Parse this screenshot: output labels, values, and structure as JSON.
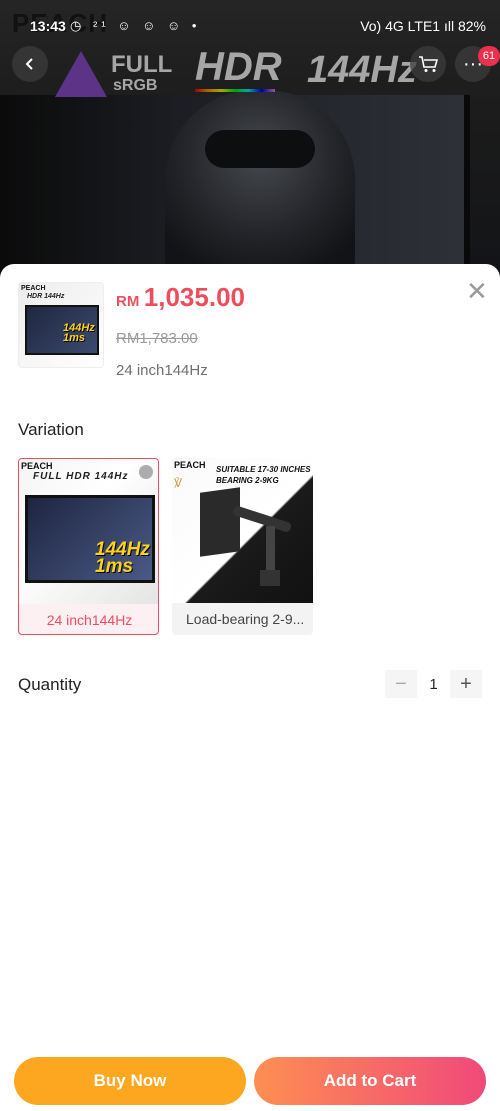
{
  "status_bar": {
    "time": "13:43",
    "notification_icons": "◷ ²¹ ☺ ☺ ☺ •",
    "right_text": "Vo) 4G LTE1 ıll 82%"
  },
  "hero": {
    "brand": "PEACH",
    "logo_full": "FULL",
    "logo_srgb": "sRGB",
    "logo_hdr": "HDR",
    "logo_hz": "144Hz",
    "cart_badge": "61"
  },
  "product": {
    "currency": "RM",
    "price": "1,035.00",
    "original_price": "RM1,783.00",
    "selected_variation": "24 inch144Hz",
    "thumb_hz": "144Hz 1ms",
    "thumb_peach": "PEACH",
    "thumb_logos": "HDR 144Hz"
  },
  "variation": {
    "title": "Variation",
    "options": [
      {
        "label": "24 inch144Hz",
        "peach": "PEACH",
        "logos": "FULL HDR 144Hz",
        "hz": "144Hz 1ms"
      },
      {
        "label": "Load-bearing 2-9...",
        "peach": "PEACH",
        "tagline": "SUITABLE 17-30 INCHES BEARING 2-9KG",
        "mark": "℣"
      }
    ]
  },
  "quantity": {
    "title": "Quantity",
    "value": "1",
    "minus": "−",
    "plus": "+"
  },
  "actions": {
    "buy_now": "Buy Now",
    "add_to_cart": "Add to Cart"
  },
  "colors": {
    "price_red": "#ee4d5e",
    "buy_orange": "#fda721",
    "cart_gradient_start": "#fd8f52",
    "cart_gradient_end": "#f0497a"
  }
}
